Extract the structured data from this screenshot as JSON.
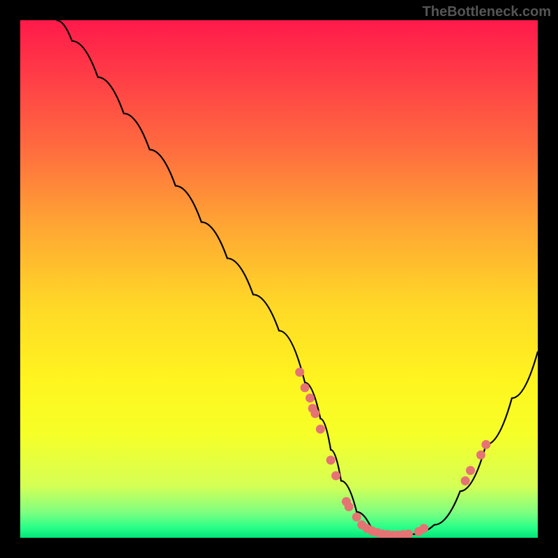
{
  "watermark": "TheBottleneck.com",
  "chart_data": {
    "type": "line",
    "title": "",
    "xlabel": "",
    "ylabel": "",
    "xlim": [
      0,
      100
    ],
    "ylim": [
      0,
      100
    ],
    "curve": {
      "x": [
        7,
        10,
        15,
        20,
        25,
        30,
        35,
        40,
        45,
        50,
        55,
        58,
        60,
        62,
        65,
        68,
        70,
        73,
        76,
        80,
        85,
        90,
        95,
        100
      ],
      "y": [
        100,
        96,
        89,
        82,
        75,
        68,
        61,
        54,
        47,
        40,
        30,
        23,
        17,
        11,
        5,
        1.5,
        0.6,
        0.5,
        0.7,
        2.5,
        9,
        18,
        27,
        36
      ]
    },
    "markers": [
      {
        "x": 54,
        "y": 32
      },
      {
        "x": 55,
        "y": 29
      },
      {
        "x": 56,
        "y": 27
      },
      {
        "x": 56.5,
        "y": 25
      },
      {
        "x": 57,
        "y": 24
      },
      {
        "x": 58,
        "y": 21
      },
      {
        "x": 60,
        "y": 15
      },
      {
        "x": 61,
        "y": 12
      },
      {
        "x": 63,
        "y": 7
      },
      {
        "x": 63.5,
        "y": 6
      },
      {
        "x": 65,
        "y": 4
      },
      {
        "x": 66,
        "y": 2.5
      },
      {
        "x": 67,
        "y": 1.8
      },
      {
        "x": 68,
        "y": 1.3
      },
      {
        "x": 69,
        "y": 1.0
      },
      {
        "x": 70,
        "y": 0.7
      },
      {
        "x": 71,
        "y": 0.6
      },
      {
        "x": 72,
        "y": 0.5
      },
      {
        "x": 73,
        "y": 0.5
      },
      {
        "x": 74,
        "y": 0.6
      },
      {
        "x": 75,
        "y": 0.7
      },
      {
        "x": 77,
        "y": 1.2
      },
      {
        "x": 78,
        "y": 1.8
      },
      {
        "x": 86,
        "y": 11
      },
      {
        "x": 87,
        "y": 13
      },
      {
        "x": 89,
        "y": 16
      },
      {
        "x": 90,
        "y": 18
      }
    ],
    "marker_color": "#e57373",
    "curve_color": "#000000"
  }
}
